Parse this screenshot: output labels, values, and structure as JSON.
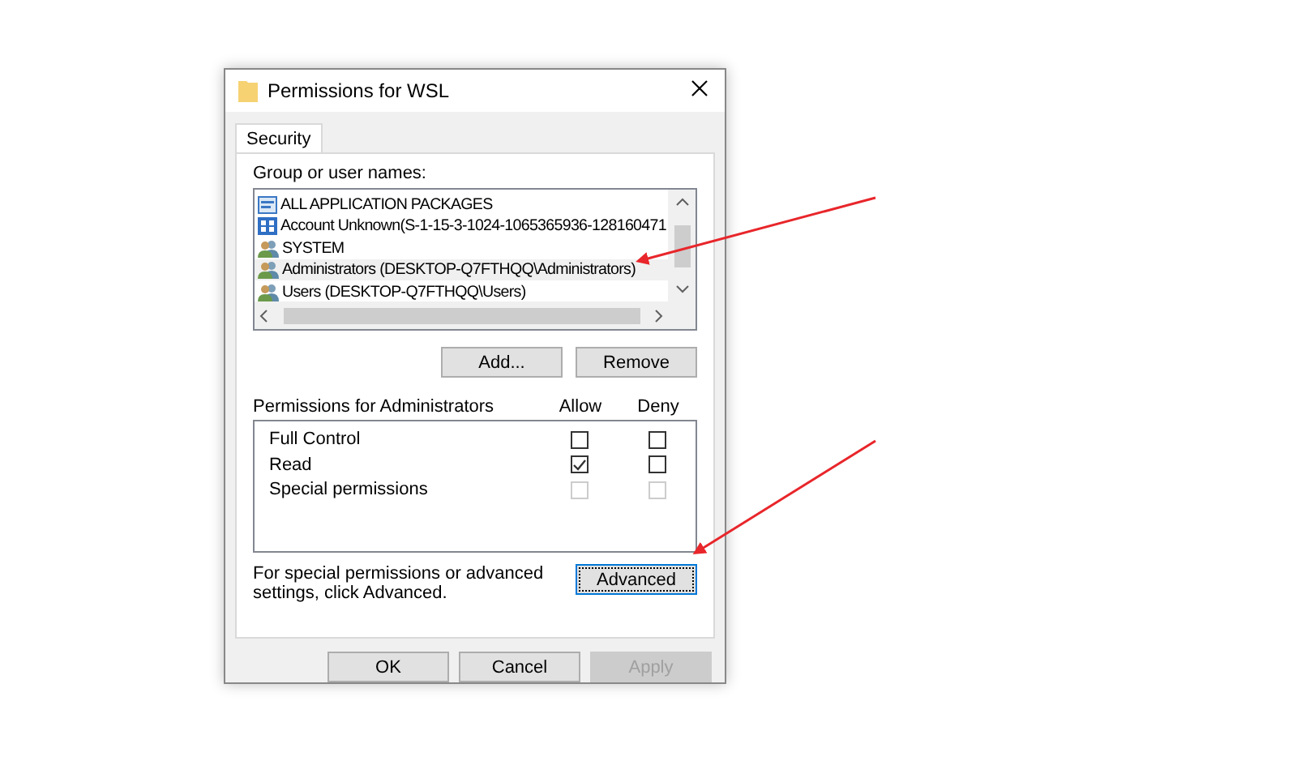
{
  "window": {
    "title": "Permissions for WSL"
  },
  "tabs": [
    {
      "label": "Security",
      "selected": true
    }
  ],
  "users": {
    "label": "Group or user names:",
    "items": [
      {
        "name": "ALL APPLICATION PACKAGES",
        "kind": "package",
        "selected": false
      },
      {
        "name": "Account Unknown(S-1-15-3-1024-1065365936-128160471",
        "kind": "unknown",
        "selected": false
      },
      {
        "name": "SYSTEM",
        "kind": "group",
        "selected": false
      },
      {
        "name": "Administrators (DESKTOP-Q7FTHQQ\\Administrators)",
        "kind": "group",
        "selected": true
      },
      {
        "name": "Users (DESKTOP-Q7FTHQQ\\Users)",
        "kind": "group",
        "selected": false
      }
    ]
  },
  "user_buttons": [
    {
      "label": "Add..."
    },
    {
      "label": "Remove"
    }
  ],
  "permissions": {
    "label": "Permissions for Administrators",
    "allow_label": "Allow",
    "deny_label": "Deny",
    "rows": [
      {
        "name": "Full Control",
        "allow": {
          "checked": false,
          "disabled": false
        },
        "deny": {
          "checked": false,
          "disabled": false
        }
      },
      {
        "name": "Read",
        "allow": {
          "checked": true,
          "disabled": false
        },
        "deny": {
          "checked": false,
          "disabled": false
        }
      },
      {
        "name": "Special permissions",
        "allow": {
          "checked": false,
          "disabled": true
        },
        "deny": {
          "checked": false,
          "disabled": true
        }
      }
    ]
  },
  "advanced": {
    "text": "For special permissions or advanced settings, click Advanced.",
    "button": "Advanced",
    "focused": true
  },
  "buttons": [
    {
      "label": "OK",
      "disabled": false
    },
    {
      "label": "Cancel",
      "disabled": false
    },
    {
      "label": "Apply",
      "disabled": true
    }
  ]
}
